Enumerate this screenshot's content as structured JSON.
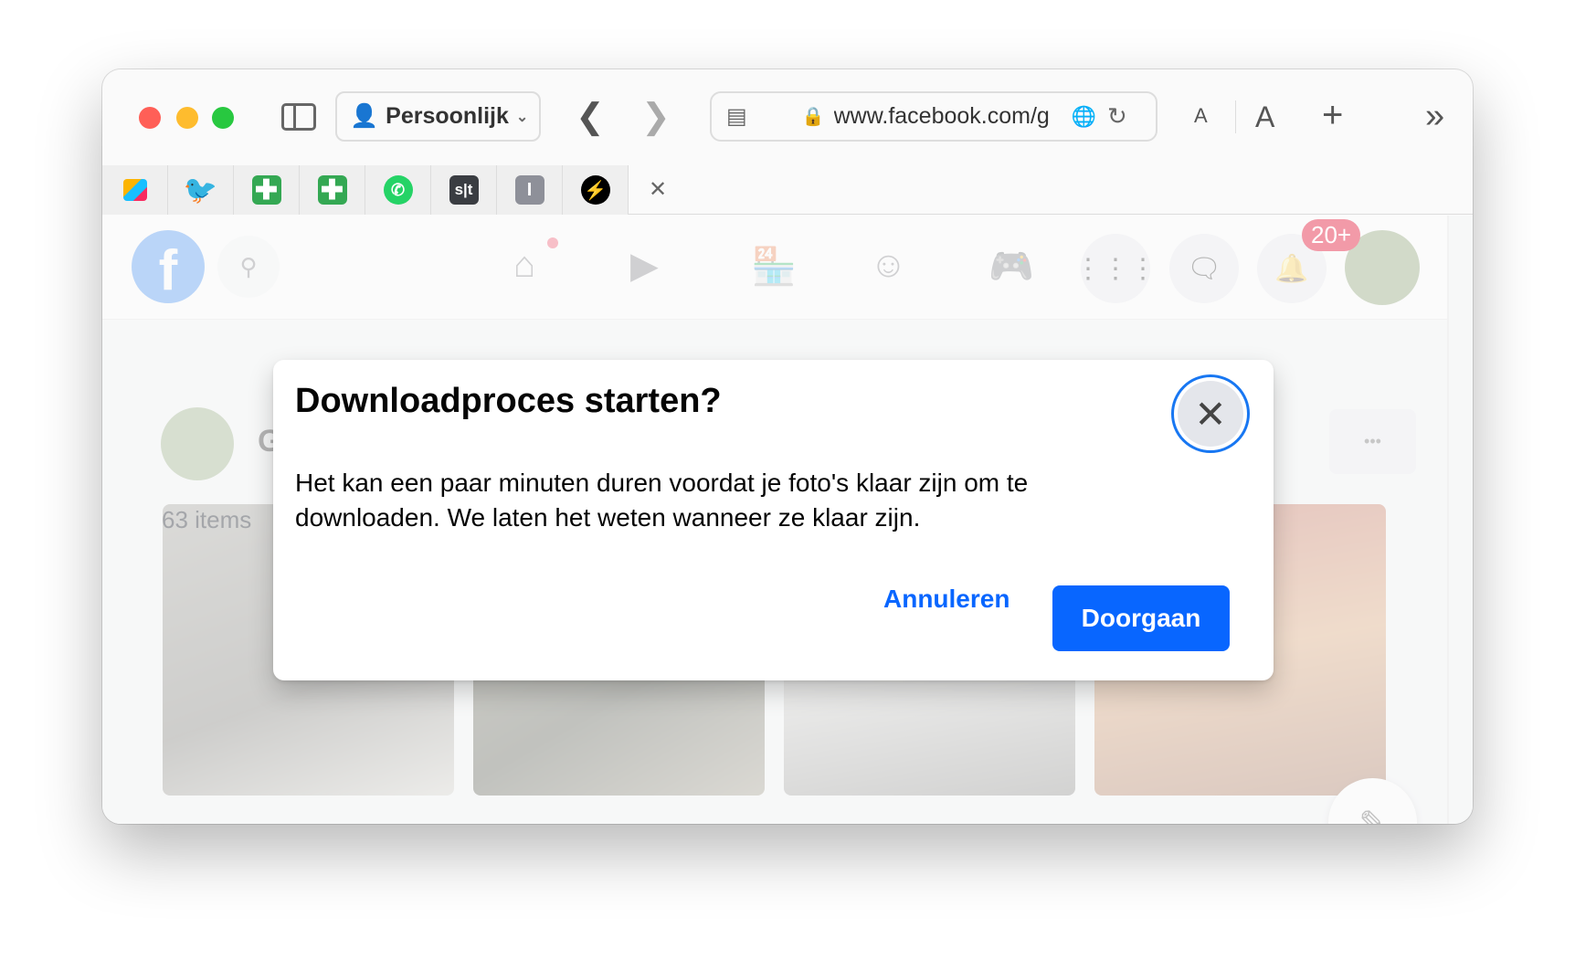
{
  "browser": {
    "profile_label": "Persoonlijk",
    "url": "www.facebook.com/g",
    "text_smaller": "A",
    "text_larger": "A",
    "new_tab": "+",
    "more": "»",
    "tabs": [
      {
        "icon": "airtable-icon"
      },
      {
        "icon": "twitter-icon"
      },
      {
        "icon": "google-sheets-icon"
      },
      {
        "icon": "google-sheets-icon"
      },
      {
        "icon": "whatsapp-icon"
      },
      {
        "icon": "st-icon",
        "text": "s|t"
      },
      {
        "icon": "i-icon",
        "text": "I"
      },
      {
        "icon": "bolt-icon"
      }
    ]
  },
  "facebook": {
    "notification_badge": "20+",
    "album_title_initial": "G",
    "item_count": "63 items",
    "more_label": "•••"
  },
  "dialog": {
    "title": "Downloadproces starten?",
    "body": "Het kan een paar minuten duren voordat je foto's klaar zijn om te downloaden. We laten het weten wanneer ze klaar zijn.",
    "cancel_label": "Annuleren",
    "confirm_label": "Doorgaan",
    "accent": "#0866ff"
  }
}
